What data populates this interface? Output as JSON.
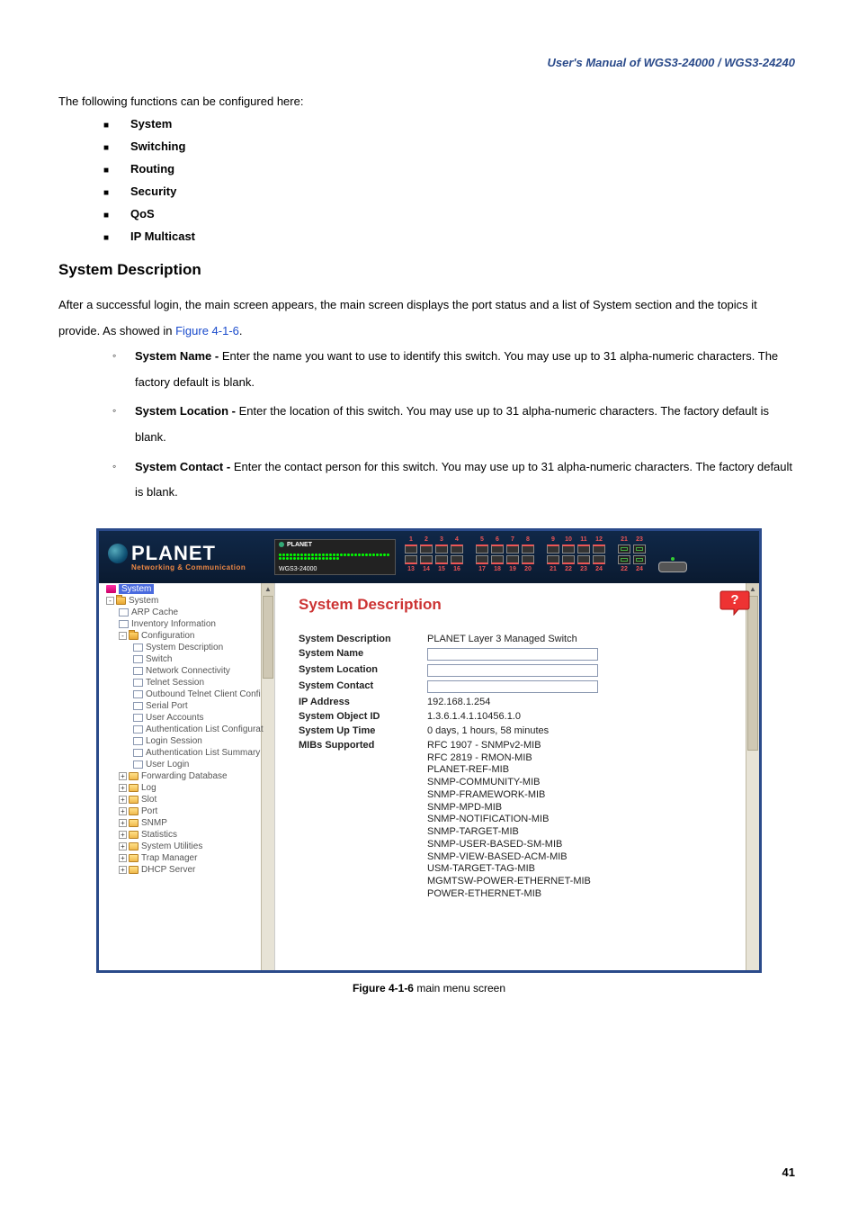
{
  "manual_header": "User's Manual of WGS3-24000 / WGS3-24240",
  "intro": "The following functions can be configured here:",
  "func_list": [
    "System",
    "Switching",
    "Routing",
    "Security",
    "QoS",
    "IP Multicast"
  ],
  "sect_title": "System Description",
  "para1_a": "After a successful login, the main screen appears, the main screen displays the port status and a list of System section and the topics it provide. As showed in ",
  "para1_link": "Figure 4-1-6",
  "para1_b": ".",
  "bullets": [
    {
      "t": "System Name - ",
      "d": "Enter the name you want to use to identify this switch. You may use up to 31 alpha-numeric characters. The factory default is blank."
    },
    {
      "t": "System Location - ",
      "d": "Enter the location of this switch. You may use up to 31 alpha-numeric characters. The factory default is blank."
    },
    {
      "t": "System Contact - ",
      "d": "Enter the contact person for this switch. You may use up to 31 alpha-numeric characters. The factory default is blank."
    }
  ],
  "logo_main": "PLANET",
  "logo_sub": "Networking & Communication",
  "dev_brand": "PLANET",
  "dev_model": "WGS3-24000",
  "port_top": [
    "1",
    "2",
    "3",
    "4",
    "5",
    "6",
    "7",
    "8",
    "9",
    "10",
    "11",
    "12"
  ],
  "port_bot": [
    "13",
    "14",
    "15",
    "16",
    "17",
    "18",
    "19",
    "20",
    "21",
    "22",
    "23",
    "24"
  ],
  "sfp_top": [
    "21",
    "23"
  ],
  "sfp_bot": [
    "22",
    "24"
  ],
  "tree": {
    "root": "System",
    "l1_system": "System",
    "arp": "ARP Cache",
    "inv": "Inventory Information",
    "conf": "Configuration",
    "sd": "System Description",
    "sw": "Switch",
    "nc": "Network Connectivity",
    "ts": "Telnet Session",
    "otcc": "Outbound Telnet Client Confi",
    "sp": "Serial Port",
    "ua": "User Accounts",
    "alc": "Authentication List Configurat",
    "ls": "Login Session",
    "als": "Authentication List Summary",
    "ul": "User Login",
    "fd": "Forwarding Database",
    "log": "Log",
    "slot": "Slot",
    "port": "Port",
    "snmp": "SNMP",
    "stat": "Statistics",
    "su": "System Utilities",
    "tm": "Trap Manager",
    "dhcp": "DHCP Server"
  },
  "content_title": "System Description",
  "rows": {
    "sd_l": "System Description",
    "sd_v": "PLANET Layer 3 Managed Switch",
    "sn_l": "System Name",
    "sl_l": "System Location",
    "sc_l": "System Contact",
    "ip_l": "IP Address",
    "ip_v": "192.168.1.254",
    "oid_l": "System Object ID",
    "oid_v": "1.3.6.1.4.1.10456.1.0",
    "up_l": "System Up Time",
    "up_v": "0 days, 1 hours, 58 minutes",
    "mib_l": "MIBs Supported"
  },
  "mibs": [
    "RFC 1907 - SNMPv2-MIB",
    "RFC 2819 - RMON-MIB",
    "PLANET-REF-MIB",
    "SNMP-COMMUNITY-MIB",
    "SNMP-FRAMEWORK-MIB",
    "SNMP-MPD-MIB",
    "SNMP-NOTIFICATION-MIB",
    "SNMP-TARGET-MIB",
    "SNMP-USER-BASED-SM-MIB",
    "SNMP-VIEW-BASED-ACM-MIB",
    "USM-TARGET-TAG-MIB",
    "MGMTSW-POWER-ETHERNET-MIB",
    "POWER-ETHERNET-MIB"
  ],
  "fig_label": "Figure 4-1-6",
  "fig_text": " main menu screen",
  "page_num": "41"
}
